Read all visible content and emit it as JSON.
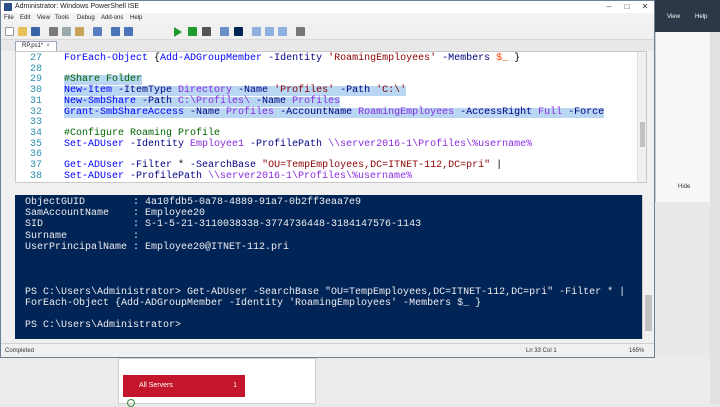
{
  "window": {
    "title": "Administrator: Windows PowerShell ISE"
  },
  "menu": [
    "File",
    "Edit",
    "View",
    "Tools",
    "Debug",
    "Add-ons",
    "Help"
  ],
  "tab": {
    "name": "RP.ps1*",
    "close": "×"
  },
  "script_lines": [
    {
      "num": "27",
      "selected": false,
      "tokens": [
        {
          "t": "ForEach-Object ",
          "c": "cmd"
        },
        {
          "t": "{",
          "c": "plain"
        },
        {
          "t": "Add-ADGroupMember ",
          "c": "cmd"
        },
        {
          "t": "-Identity ",
          "c": "param"
        },
        {
          "t": "'RoamingEmployees' ",
          "c": "str"
        },
        {
          "t": "-Members ",
          "c": "param"
        },
        {
          "t": "$_ ",
          "c": "var"
        },
        {
          "t": "}",
          "c": "plain"
        }
      ]
    },
    {
      "num": "28",
      "selected": false,
      "tokens": []
    },
    {
      "num": "29",
      "selected": true,
      "tokens": [
        {
          "t": "#Share Folder",
          "c": "cmt"
        }
      ]
    },
    {
      "num": "30",
      "selected": true,
      "tokens": [
        {
          "t": "New-Item ",
          "c": "cmd"
        },
        {
          "t": "-ItemType ",
          "c": "param"
        },
        {
          "t": "Directory ",
          "c": "arg"
        },
        {
          "t": "-Name ",
          "c": "param"
        },
        {
          "t": "'Profiles' ",
          "c": "str"
        },
        {
          "t": "-Path ",
          "c": "param"
        },
        {
          "t": "'C:\\'",
          "c": "str"
        }
      ]
    },
    {
      "num": "31",
      "selected": true,
      "tokens": [
        {
          "t": "New-SmbShare ",
          "c": "cmd"
        },
        {
          "t": "-Path ",
          "c": "param"
        },
        {
          "t": "C:\\Profiles\\ ",
          "c": "arg"
        },
        {
          "t": "-Name ",
          "c": "param"
        },
        {
          "t": "Profiles",
          "c": "arg"
        }
      ]
    },
    {
      "num": "32",
      "selected": true,
      "tokens": [
        {
          "t": "Grant-SmbShareAccess ",
          "c": "cmd"
        },
        {
          "t": "-Name ",
          "c": "param"
        },
        {
          "t": "Profiles ",
          "c": "arg"
        },
        {
          "t": "-AccountName ",
          "c": "param"
        },
        {
          "t": "RoamingEmployees ",
          "c": "arg"
        },
        {
          "t": "-AccessRight ",
          "c": "param"
        },
        {
          "t": "Full ",
          "c": "arg"
        },
        {
          "t": "-Force",
          "c": "param"
        }
      ]
    },
    {
      "num": "33",
      "selected": false,
      "tokens": []
    },
    {
      "num": "34",
      "selected": false,
      "tokens": [
        {
          "t": "#Configure Roaming Profile",
          "c": "cmt"
        }
      ]
    },
    {
      "num": "35",
      "selected": false,
      "tokens": [
        {
          "t": "Set-ADUser ",
          "c": "cmd"
        },
        {
          "t": "-Identity ",
          "c": "param"
        },
        {
          "t": "Employee1 ",
          "c": "arg"
        },
        {
          "t": "-ProfilePath ",
          "c": "param"
        },
        {
          "t": "\\\\server2016-1\\Profiles\\%username%",
          "c": "arg"
        }
      ]
    },
    {
      "num": "36",
      "selected": false,
      "tokens": []
    },
    {
      "num": "37",
      "selected": false,
      "tokens": [
        {
          "t": "Get-ADUser ",
          "c": "cmd"
        },
        {
          "t": "-Filter ",
          "c": "param"
        },
        {
          "t": "* ",
          "c": "plain"
        },
        {
          "t": "-SearchBase ",
          "c": "param"
        },
        {
          "t": "\"OU=TempEmployees,DC=ITNET-112,DC=pri\" ",
          "c": "str"
        },
        {
          "t": "|",
          "c": "plain"
        }
      ]
    },
    {
      "num": "38",
      "selected": false,
      "tokens": [
        {
          "t": "Set-ADUser ",
          "c": "cmd"
        },
        {
          "t": "-ProfilePath ",
          "c": "param"
        },
        {
          "t": "\\\\server2016-1\\Profiles\\%username%",
          "c": "arg"
        }
      ]
    }
  ],
  "console_lines": [
    "ObjectGUID        : 4a10fdb5-0a78-4889-91a7-0b2ff3eaa7e9",
    "SamAccountName    : Employee20",
    "SID               : S-1-5-21-3110038338-3774736448-3184147576-1143",
    "Surname           :",
    "UserPrincipalName : Employee20@ITNET-112.pri",
    "",
    "",
    "",
    "PS C:\\Users\\Administrator> Get-ADUser -SearchBase \"OU=TempEmployees,DC=ITNET-112,DC=pri\" -Filter * |",
    "ForEach-Object {Add-ADGroupMember -Identity 'RoamingEmployees' -Members $_ }",
    "",
    "PS C:\\Users\\Administrator>"
  ],
  "status": {
    "left": "Completed",
    "position": "Ln 33  Col 1",
    "zoom": "165%"
  },
  "server_manager": {
    "view": "View",
    "help": "Help",
    "hide": "Hide",
    "tile_label": "All Servers",
    "tile_count": "1"
  },
  "colors": {
    "console_bg": "#012456",
    "selection": "#b9d7f3",
    "tile_red": "#c3162b"
  }
}
